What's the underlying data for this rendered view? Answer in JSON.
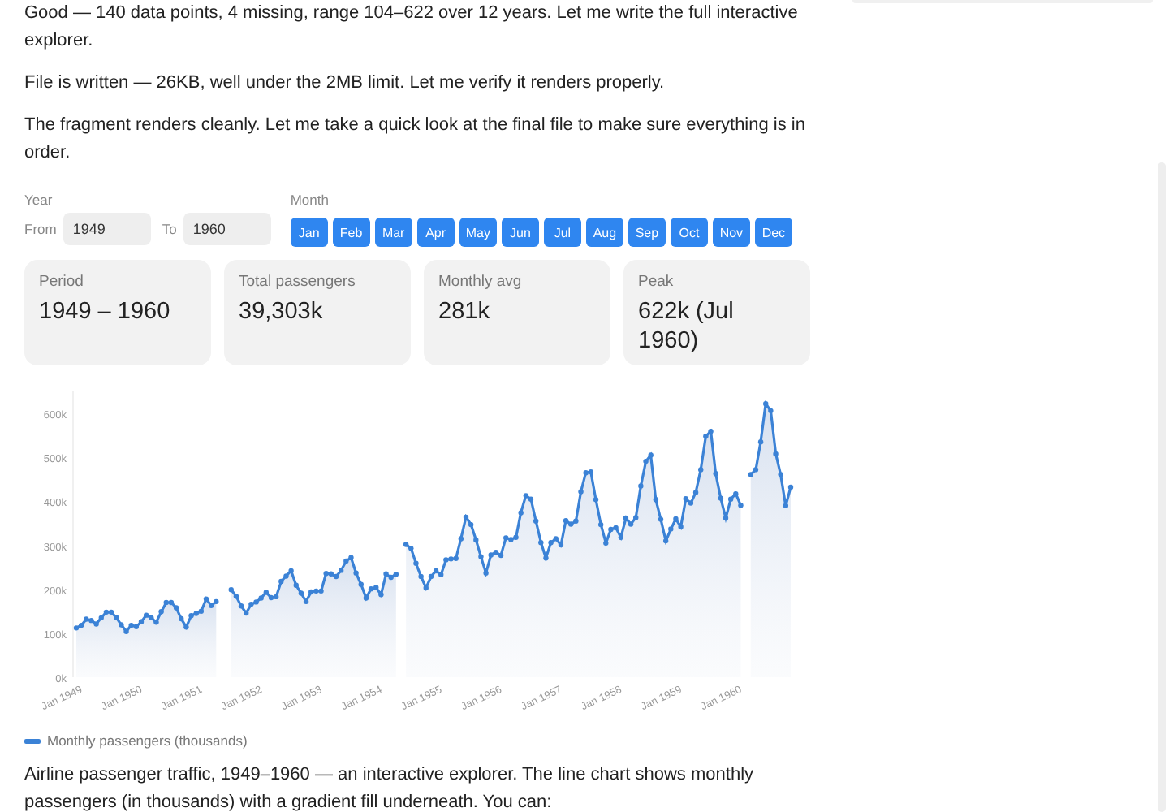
{
  "messages_before": [
    "Good — 140 data points, 4 missing, range 104–622 over 12 years. Let me write the full interactive explorer.",
    "File is written — 26KB, well under the 2MB limit. Let me verify it renders properly.",
    "The fragment renders cleanly. Let me take a quick look at the final file to make sure everything is in order."
  ],
  "filters": {
    "year_label": "Year",
    "from_label": "From",
    "from_value": "1949",
    "to_label": "To",
    "to_value": "1960",
    "month_label": "Month",
    "months": [
      {
        "label": "Jan",
        "selected": true
      },
      {
        "label": "Feb",
        "selected": true
      },
      {
        "label": "Mar",
        "selected": true
      },
      {
        "label": "Apr",
        "selected": true
      },
      {
        "label": "May",
        "selected": true
      },
      {
        "label": "Jun",
        "selected": true
      },
      {
        "label": "Jul",
        "selected": true
      },
      {
        "label": "Aug",
        "selected": true
      },
      {
        "label": "Sep",
        "selected": true
      },
      {
        "label": "Oct",
        "selected": true
      },
      {
        "label": "Nov",
        "selected": true
      },
      {
        "label": "Dec",
        "selected": true
      }
    ]
  },
  "stats": [
    {
      "label": "Period",
      "value": "1949 – 1960"
    },
    {
      "label": "Total passengers",
      "value": "39,303k"
    },
    {
      "label": "Monthly avg",
      "value": "281k"
    },
    {
      "label": "Peak",
      "value": "622k (Jul 1960)"
    }
  ],
  "chart_data": {
    "type": "area",
    "categories": [
      "Jan 1949",
      null,
      null,
      null,
      null,
      null,
      null,
      null,
      null,
      null,
      null,
      null,
      "Jan 1950",
      null,
      null,
      null,
      null,
      null,
      null,
      null,
      null,
      null,
      null,
      null,
      "Jan 1951",
      null,
      null,
      null,
      null,
      null,
      null,
      null,
      null,
      null,
      null,
      null,
      "Jan 1952",
      null,
      null,
      null,
      null,
      null,
      null,
      null,
      null,
      null,
      null,
      null,
      "Jan 1953",
      null,
      null,
      null,
      null,
      null,
      null,
      null,
      null,
      null,
      null,
      null,
      "Jan 1954",
      null,
      null,
      null,
      null,
      null,
      null,
      null,
      null,
      null,
      null,
      null,
      "Jan 1955",
      null,
      null,
      null,
      null,
      null,
      null,
      null,
      null,
      null,
      null,
      null,
      "Jan 1956",
      null,
      null,
      null,
      null,
      null,
      null,
      null,
      null,
      null,
      null,
      null,
      "Jan 1957",
      null,
      null,
      null,
      null,
      null,
      null,
      null,
      null,
      null,
      null,
      null,
      "Jan 1958",
      null,
      null,
      null,
      null,
      null,
      null,
      null,
      null,
      null,
      null,
      null,
      "Jan 1959",
      null,
      null,
      null,
      null,
      null,
      null,
      null,
      null,
      null,
      null,
      null,
      "Jan 1960",
      null,
      null,
      null,
      null,
      null,
      null,
      null,
      null,
      null,
      null,
      null
    ],
    "ylim": [
      0,
      650
    ],
    "series": [
      {
        "name": "Monthly passengers (thousands)",
        "color": "#3b82d6",
        "values": [
          112,
          118,
          132,
          129,
          121,
          135,
          148,
          148,
          136,
          119,
          104,
          118,
          115,
          126,
          141,
          135,
          125,
          149,
          170,
          170,
          158,
          133,
          114,
          140,
          145,
          150,
          178,
          163,
          172,
          null,
          null,
          199,
          184,
          162,
          146,
          166,
          171,
          180,
          193,
          181,
          183,
          218,
          230,
          242,
          209,
          191,
          172,
          194,
          196,
          196,
          236,
          235,
          229,
          243,
          264,
          272,
          237,
          211,
          180,
          201,
          204,
          188,
          235,
          227,
          234,
          null,
          302,
          293,
          259,
          229,
          203,
          229,
          242,
          233,
          267,
          269,
          270,
          315,
          364,
          347,
          312,
          274,
          237,
          278,
          284,
          277,
          317,
          313,
          318,
          374,
          413,
          405,
          355,
          306,
          271,
          306,
          315,
          301,
          356,
          348,
          355,
          422,
          465,
          467,
          404,
          347,
          305,
          336,
          340,
          318,
          362,
          348,
          363,
          435,
          491,
          505,
          404,
          359,
          310,
          337,
          360,
          342,
          406,
          396,
          420,
          472,
          548,
          559,
          463,
          407,
          362,
          405,
          417,
          391,
          null,
          461,
          472,
          535,
          622,
          606,
          508,
          461,
          390,
          432
        ]
      }
    ],
    "yticks": [
      {
        "value": 0,
        "label": "0k"
      },
      {
        "value": 100,
        "label": "100k"
      },
      {
        "value": 200,
        "label": "200k"
      },
      {
        "value": 300,
        "label": "300k"
      },
      {
        "value": 400,
        "label": "400k"
      },
      {
        "value": 500,
        "label": "500k"
      },
      {
        "value": 600,
        "label": "600k"
      }
    ]
  },
  "messages_after": [
    "Airline passenger traffic, 1949–1960 — an interactive explorer. The line chart shows monthly passengers (in thousands) with a gradient fill underneath. You can:"
  ]
}
